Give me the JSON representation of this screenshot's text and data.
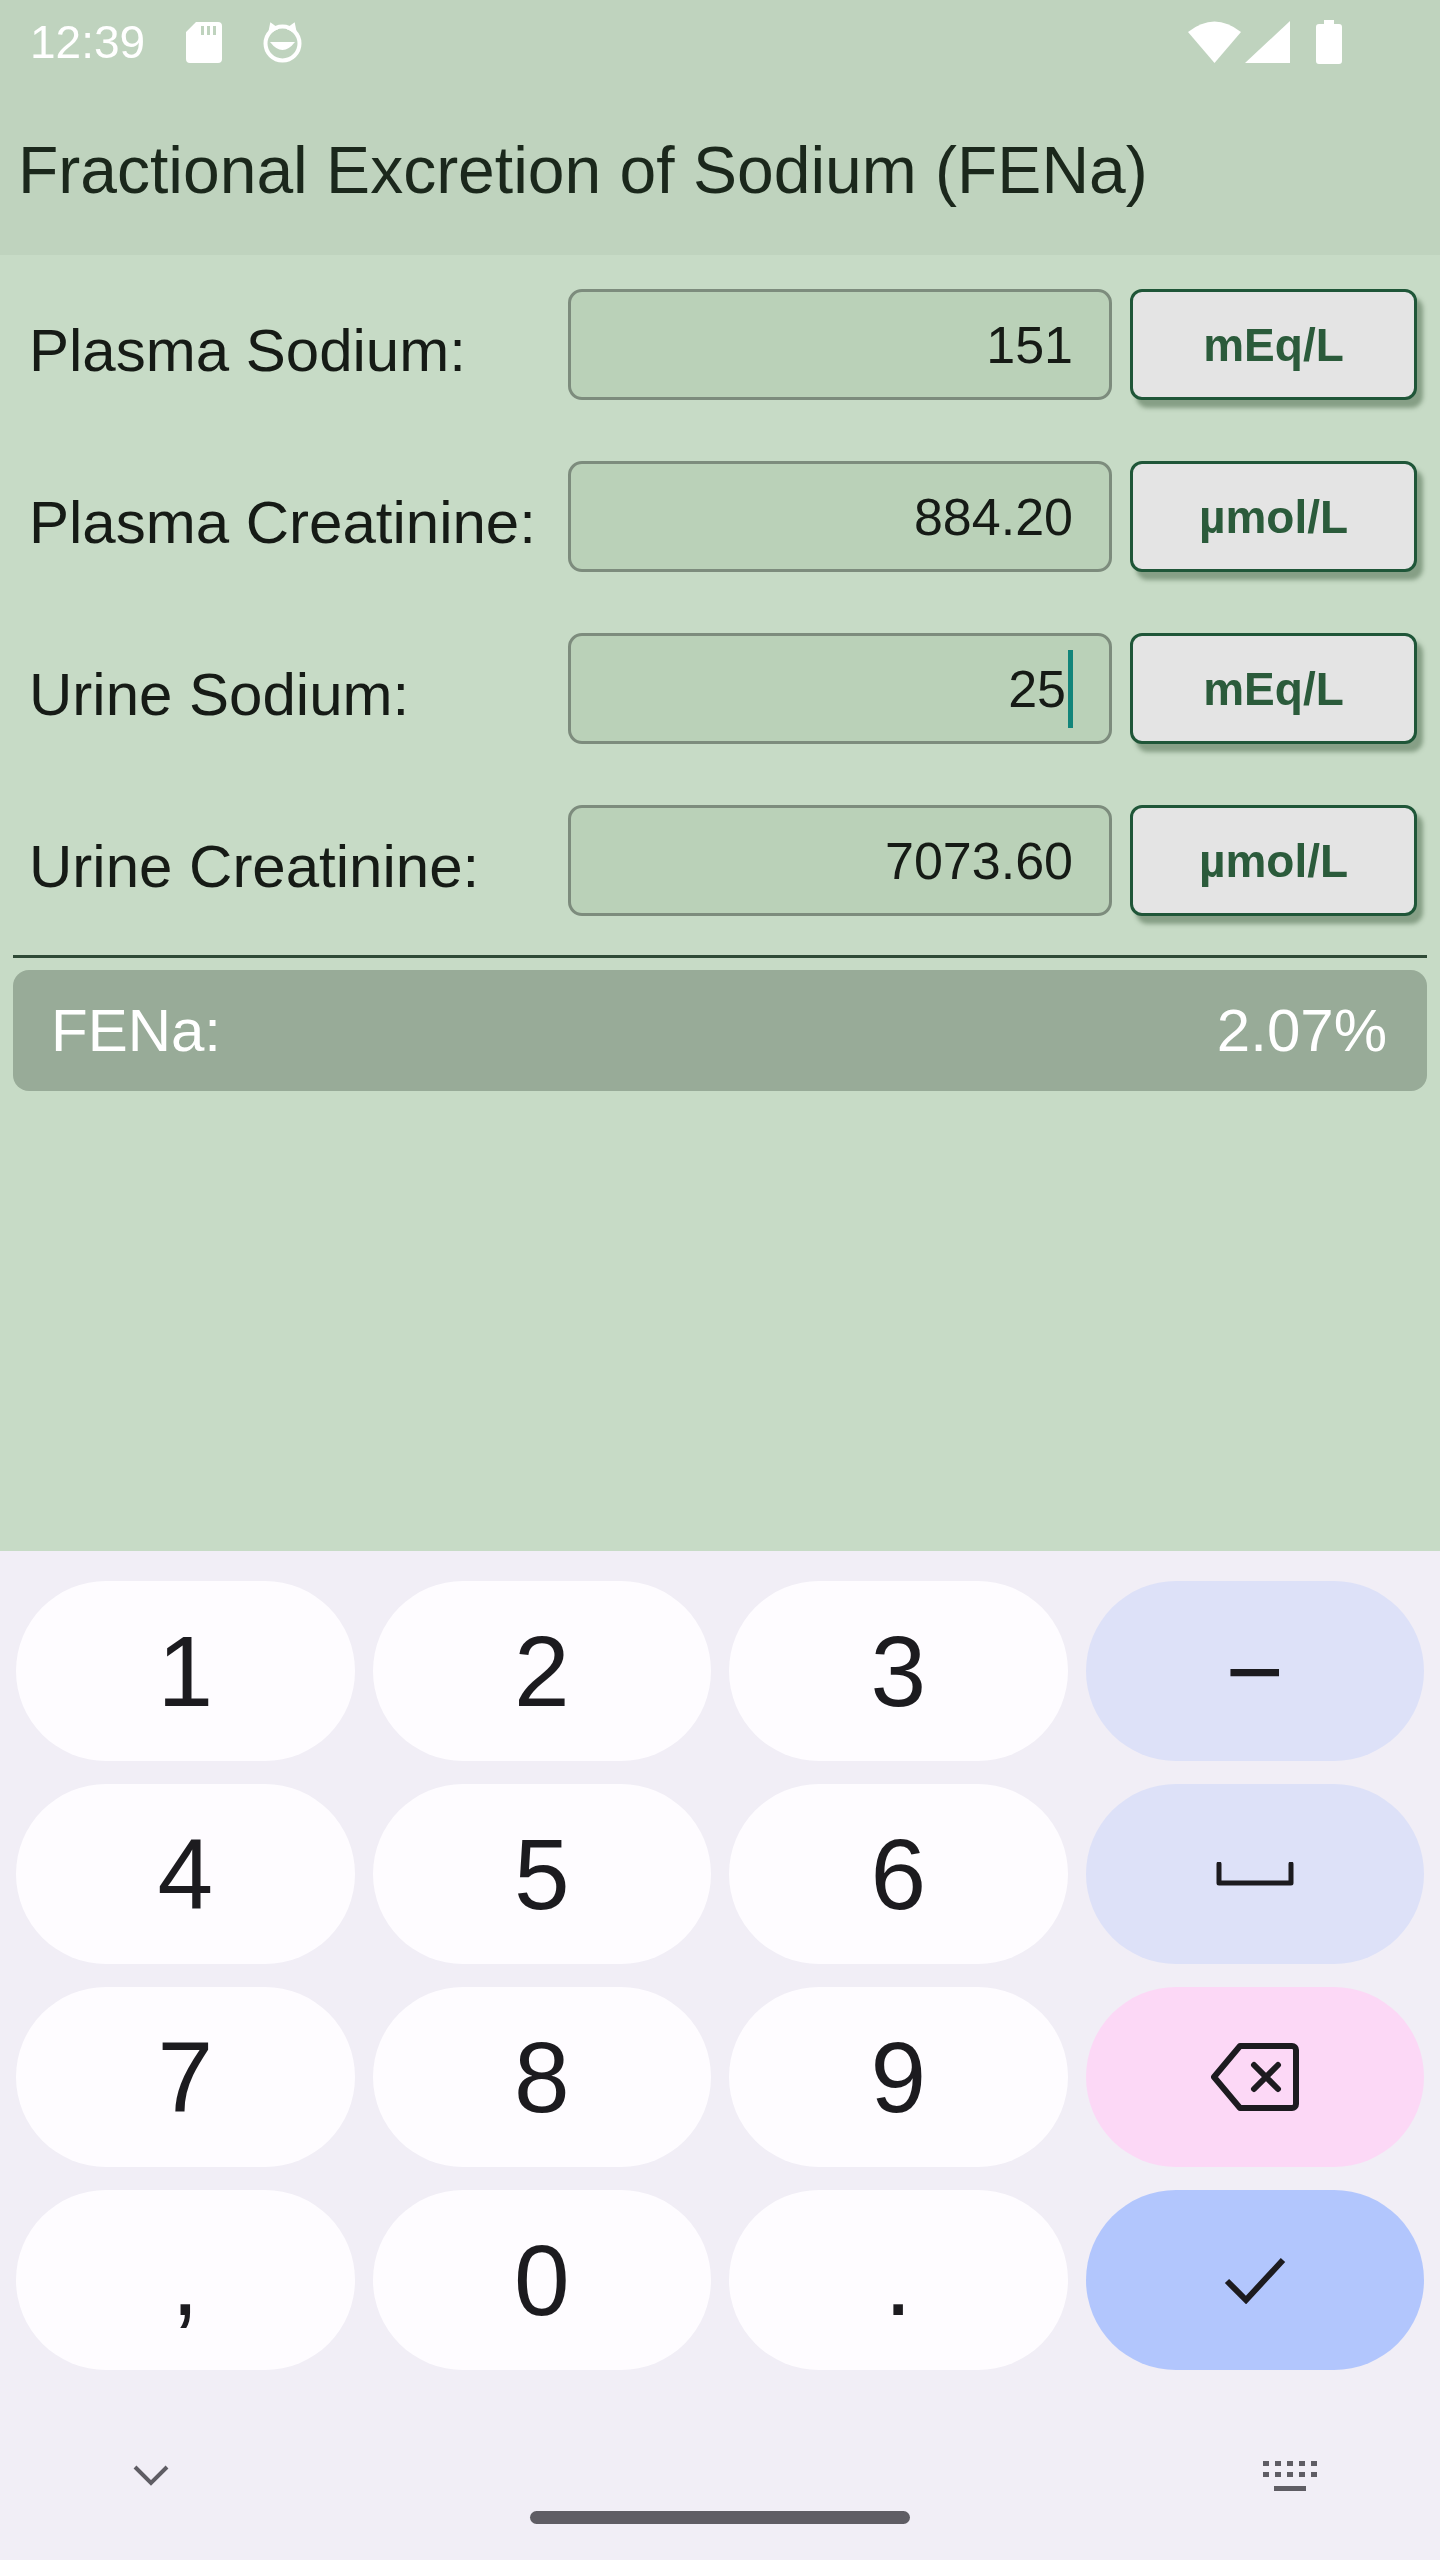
{
  "status_bar": {
    "time": "12:39"
  },
  "app_bar": {
    "title": "Fractional Excretion of Sodium (FENa)"
  },
  "inputs": [
    {
      "label": "Plasma Sodium:",
      "value": "151",
      "unit": "mEq/L",
      "focused": false
    },
    {
      "label": "Plasma Creatinine:",
      "value": "884.20",
      "unit": "µmol/L",
      "focused": false
    },
    {
      "label": "Urine Sodium:",
      "value": "25",
      "unit": "mEq/L",
      "focused": true
    },
    {
      "label": "Urine Creatinine:",
      "value": "7073.60",
      "unit": "µmol/L",
      "focused": false
    }
  ],
  "result": {
    "label": "FENa:",
    "value": "2.07%"
  },
  "keyboard": {
    "keys": [
      {
        "kind": "char",
        "label": "1"
      },
      {
        "kind": "char",
        "label": "2"
      },
      {
        "kind": "char",
        "label": "3"
      },
      {
        "kind": "sign",
        "label": "−"
      },
      {
        "kind": "char",
        "label": "4"
      },
      {
        "kind": "char",
        "label": "5"
      },
      {
        "kind": "char",
        "label": "6"
      },
      {
        "kind": "space"
      },
      {
        "kind": "char",
        "label": "7"
      },
      {
        "kind": "char",
        "label": "8"
      },
      {
        "kind": "char",
        "label": "9"
      },
      {
        "kind": "backspace"
      },
      {
        "kind": "char",
        "label": ","
      },
      {
        "kind": "char",
        "label": "0"
      },
      {
        "kind": "char",
        "label": "."
      },
      {
        "kind": "done"
      }
    ]
  }
}
